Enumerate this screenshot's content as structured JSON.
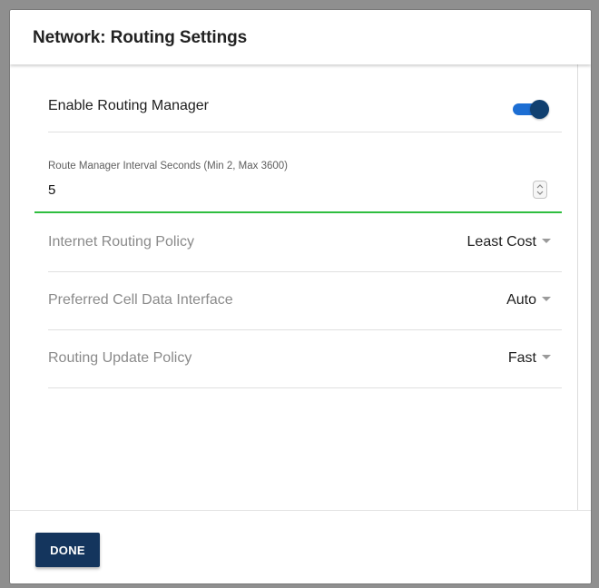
{
  "dialog": {
    "title": "Network: Routing Settings"
  },
  "routing_manager": {
    "label": "Enable Routing Manager",
    "enabled": true,
    "toggle_color": "#1d6ed3",
    "thumb_color": "#11406f"
  },
  "interval": {
    "label": "Route Manager Interval Seconds (Min 2, Max 3600)",
    "value": "5",
    "focus_color": "#2fbe3f"
  },
  "settings": [
    {
      "label": "Internet Routing Policy",
      "value": "Least Cost"
    },
    {
      "label": "Preferred Cell Data Interface",
      "value": "Auto"
    },
    {
      "label": "Routing Update Policy",
      "value": "Fast"
    }
  ],
  "footer": {
    "done_label": "DONE",
    "done_color": "#14355d"
  }
}
